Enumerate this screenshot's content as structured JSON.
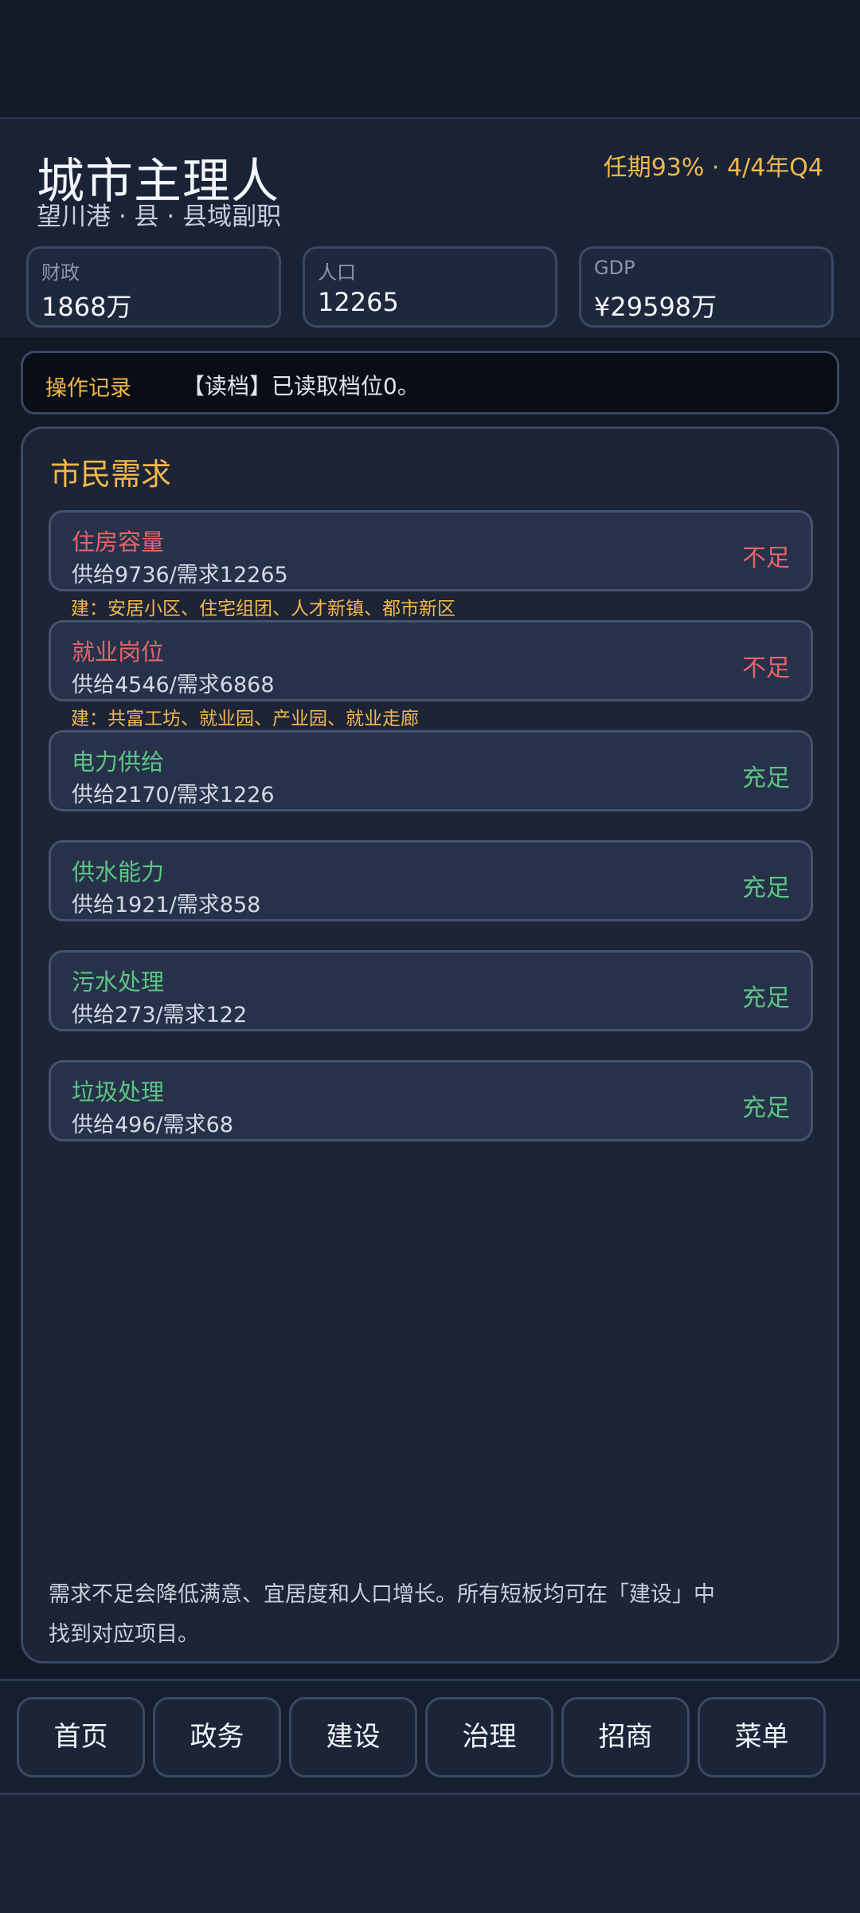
{
  "header": {
    "title": "城市主理人",
    "subtitle": "望川港 · 县 · 县域副职",
    "term_info": "任期93% · 4/4年Q4",
    "stats": [
      {
        "label": "财政",
        "value": "1868万"
      },
      {
        "label": "人口",
        "value": "12265"
      },
      {
        "label": "GDP",
        "value": "¥29598万"
      }
    ]
  },
  "log": {
    "label": "操作记录",
    "text": "【读档】已读取档位0。"
  },
  "needs": {
    "title": "市民需求",
    "items": [
      {
        "name": "住房容量",
        "detail": "供给9736/需求12265",
        "status": "不足",
        "hint": "建：安居小区、住宅组团、人才新镇、都市新区"
      },
      {
        "name": "就业岗位",
        "detail": "供给4546/需求6868",
        "status": "不足",
        "hint": "建：共富工坊、就业园、产业园、就业走廊"
      },
      {
        "name": "电力供给",
        "detail": "供给2170/需求1226",
        "status": "充足"
      },
      {
        "name": "供水能力",
        "detail": "供给1921/需求858",
        "status": "充足"
      },
      {
        "name": "污水处理",
        "detail": "供给273/需求122",
        "status": "充足"
      },
      {
        "name": "垃圾处理",
        "detail": "供给496/需求68",
        "status": "充足"
      }
    ],
    "footer": "需求不足会降低满意、宜居度和人口增长。所有短板均可在「建设」中找到对应项目。"
  },
  "nav": {
    "items": [
      "首页",
      "政务",
      "建设",
      "治理",
      "招商",
      "菜单"
    ]
  },
  "colors": {
    "accent": "#f2b84b",
    "bad": "#e5646a",
    "good": "#5cc583"
  }
}
